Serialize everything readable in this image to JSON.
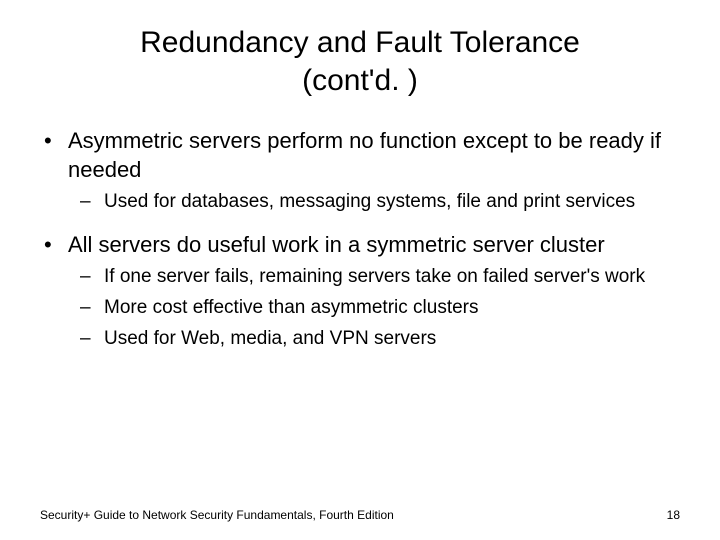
{
  "title_line1": "Redundancy and Fault Tolerance",
  "title_line2": "(cont'd. )",
  "bullets": {
    "b1": "Asymmetric servers perform no function except to be ready if needed",
    "b1_sub1": "Used for databases, messaging systems, file and print services",
    "b2": "All servers do useful work in a symmetric server cluster",
    "b2_sub1": "If one server fails, remaining servers take on failed server's work",
    "b2_sub2": "More cost effective than asymmetric clusters",
    "b2_sub3": "Used for Web, media, and VPN servers"
  },
  "footer_left": "Security+ Guide to Network Security Fundamentals, Fourth Edition",
  "footer_right": "18",
  "markers": {
    "dot": "•",
    "dash": "–"
  }
}
